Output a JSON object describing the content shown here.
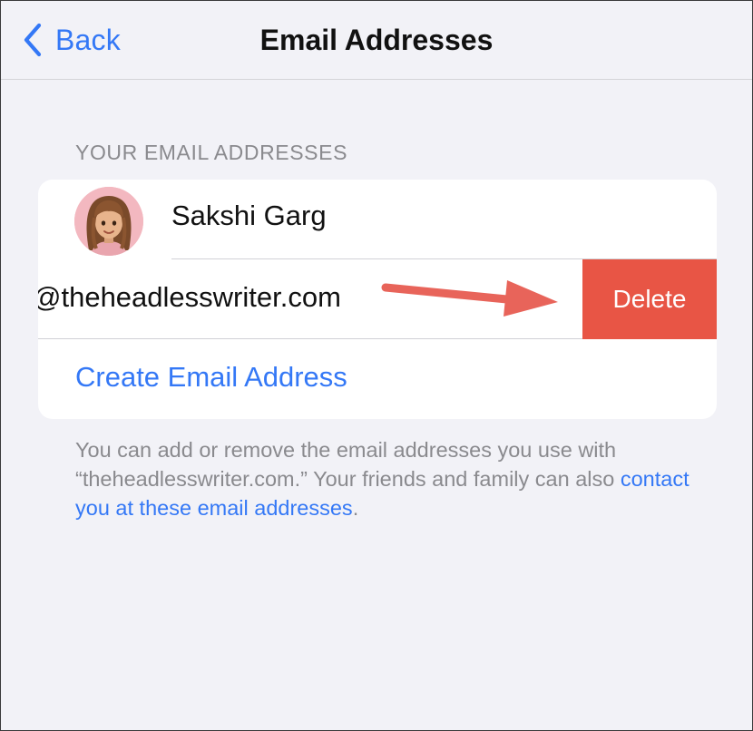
{
  "nav": {
    "back_label": "Back",
    "title": "Email Addresses"
  },
  "section": {
    "header": "YOUR EMAIL ADDRESSES"
  },
  "list": {
    "name": "Sakshi Garg",
    "email_partial": "@theheadlesswriter.com",
    "delete_label": "Delete",
    "create_label": "Create Email Address"
  },
  "footer": {
    "text_before": "You can add or remove the email addresses you use with “theheadlesswriter.com.” Your friends and family can also ",
    "link_text": "contact you at these email addresses",
    "text_after": "."
  },
  "colors": {
    "background": "#f2f2f7",
    "accent": "#3478f6",
    "delete": "#e85545",
    "annotation_arrow": "#e8645a"
  },
  "icons": {
    "back": "chevron-left-icon",
    "avatar": "memoji-avatar",
    "annotation": "red-arrow-annotation"
  }
}
